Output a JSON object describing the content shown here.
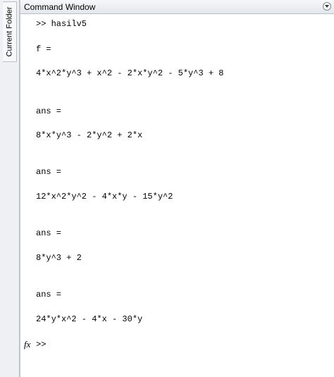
{
  "side_panel": {
    "tab_label": "Current Folder"
  },
  "window": {
    "title": "Command Window"
  },
  "lines": [
    ">> hasilv5",
    "f =",
    "4*x^2*y^3 + x^2 - 2*x*y^2 - 5*y^3 + 8",
    "ans =",
    "8*x*y^3 - 2*y^2 + 2*x",
    "ans =",
    "12*x^2*y^2 - 4*x*y - 15*y^2",
    "ans =",
    "8*y^3 + 2",
    "ans =",
    "24*y*x^2 - 4*x - 30*y"
  ],
  "prompt": {
    "icon_text": "fx",
    "text": ">>"
  }
}
